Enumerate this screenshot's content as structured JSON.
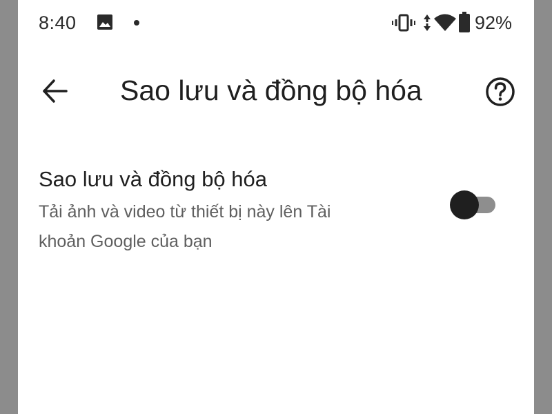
{
  "status_bar": {
    "time": "8:40",
    "battery_percent": "92%",
    "icons": [
      "gallery-icon",
      "dot-icon",
      "vibrate-icon",
      "data-arrows-icon",
      "wifi-icon",
      "battery-icon"
    ]
  },
  "app_bar": {
    "title": "Sao lưu và đồng bộ hóa",
    "back_icon": "arrow-back-icon",
    "help_icon": "help-circle-icon"
  },
  "setting": {
    "title": "Sao lưu và đồng bộ hóa",
    "description_line1": "Tải ảnh và video từ thiết bị này lên Tài",
    "description_line2": "khoản Google của bạn",
    "toggle_on": false
  },
  "colors": {
    "text_primary": "#1f1f1f",
    "text_secondary": "#5f5f5f",
    "toggle_thumb": "#1f1f1f",
    "toggle_track": "#8e8e8e",
    "bezel": "#8c8c8c"
  }
}
